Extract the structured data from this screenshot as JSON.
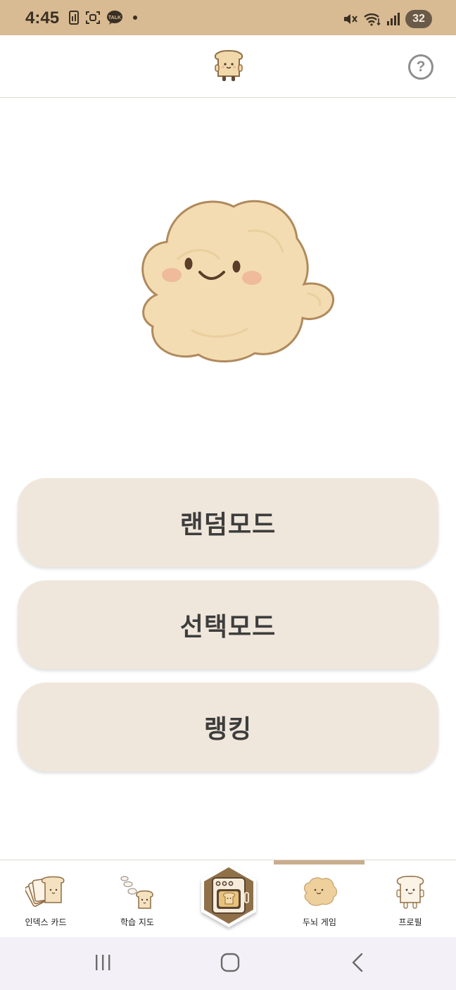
{
  "status_bar": {
    "time": "4:45",
    "battery": "32",
    "left_icons": [
      "sim-icon",
      "screenshot-icon",
      "kakaotalk-icon",
      "notification-dot-icon"
    ],
    "kakao_label": "TALK",
    "right_icons": [
      "mute-icon",
      "wifi-icon",
      "signal-icon"
    ]
  },
  "header": {
    "logo_icon": "toast-mascot-icon",
    "help_icon": "help-circle-icon",
    "help_symbol": "?"
  },
  "mascot": {
    "icon": "dough-mascot-icon"
  },
  "modes": {
    "random": "랜덤모드",
    "select": "선택모드",
    "ranking": "랭킹"
  },
  "bottom_nav": {
    "items": [
      {
        "label": "인덱스 카드",
        "icon": "index-cards-icon"
      },
      {
        "label": "학습 지도",
        "icon": "learning-map-icon"
      },
      {
        "label": "",
        "icon": "oven-icon"
      },
      {
        "label": "두뇌 게임",
        "icon": "dough-icon"
      },
      {
        "label": "프로필",
        "icon": "toast-profile-icon"
      }
    ],
    "active_index": 3
  },
  "system_nav": {
    "icons": [
      "recent-apps-icon",
      "home-icon",
      "back-icon"
    ]
  },
  "colors": {
    "status_bar": "#d8bb92",
    "button_bg": "#f0e7dc",
    "button_text": "#3d3d3d",
    "nav_indicator": "#c9ad8c",
    "oven_bg": "#8f7048"
  }
}
